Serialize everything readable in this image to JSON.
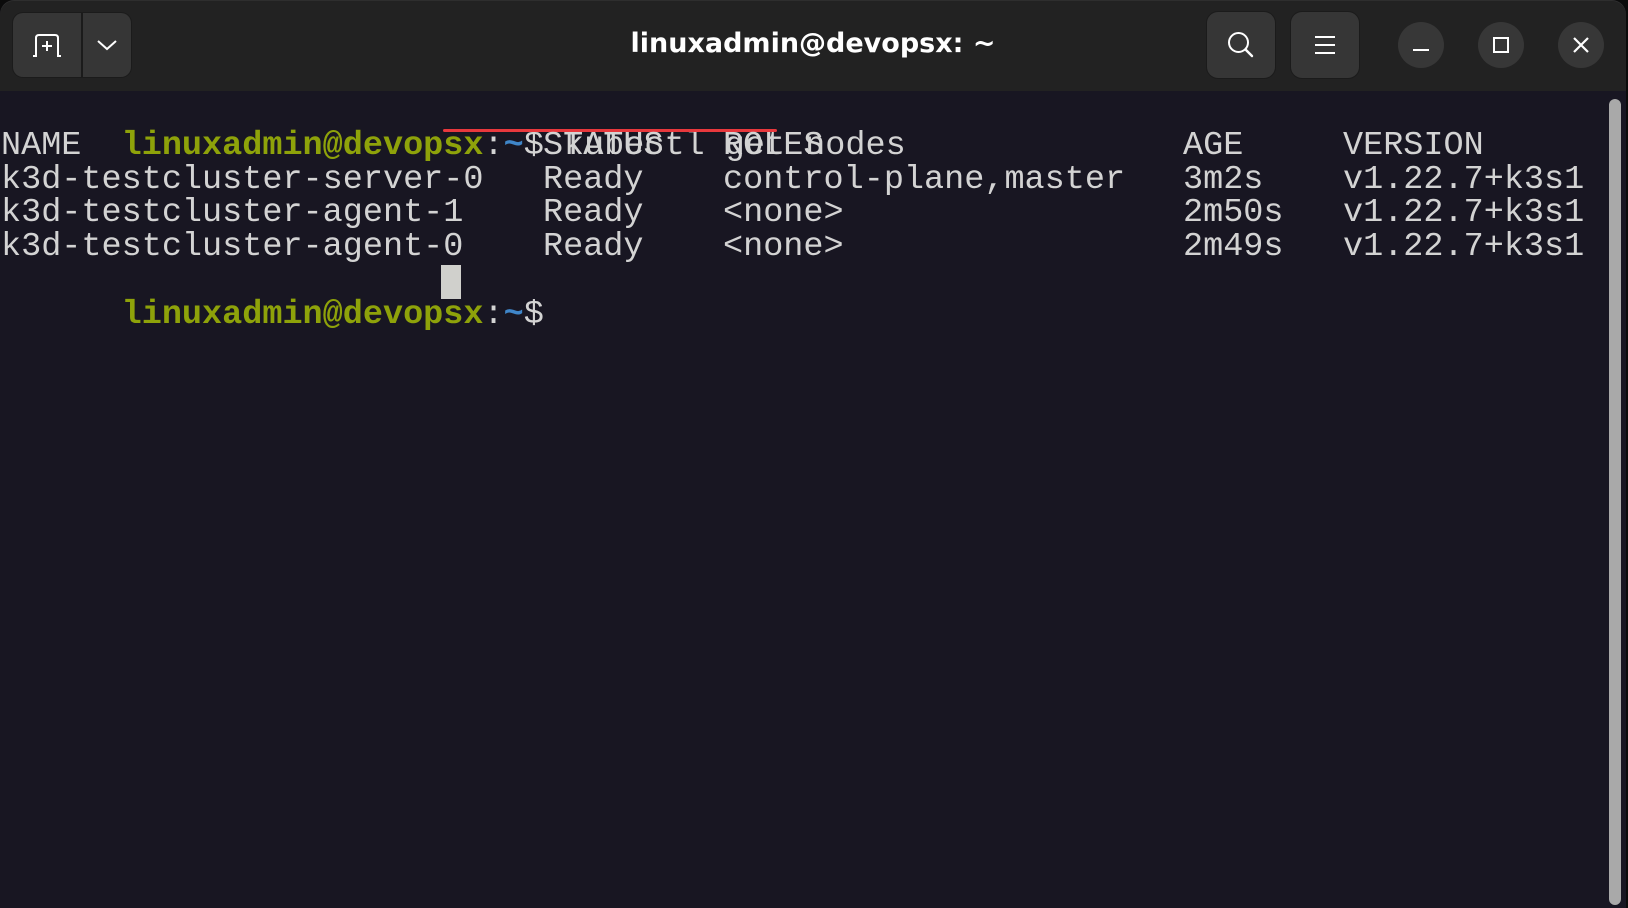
{
  "window": {
    "title": "linuxadmin@devopsx: ~"
  },
  "header": {
    "new_tab_icon": "new-tab-icon",
    "tab_menu_icon": "chevron-down-icon",
    "search_icon": "search-icon",
    "menu_icon": "hamburger-menu-icon",
    "minimize_icon": "minimize-icon",
    "maximize_icon": "maximize-icon",
    "close_icon": "close-icon"
  },
  "colors": {
    "prompt_user": "#8ea20a",
    "prompt_path": "#3f86c9",
    "text": "#d3d3d3",
    "background": "#181622",
    "annotation_underline": "#e8383d"
  },
  "terminal": {
    "prompt1": {
      "user_host": "linuxadmin@devopsx",
      "colon": ":",
      "path": "~",
      "dollar": "$",
      "command": "kubectl get nodes"
    },
    "table": {
      "headers": [
        "NAME",
        "STATUS",
        "ROLES",
        "AGE",
        "VERSION"
      ],
      "rows": [
        [
          "k3d-testcluster-server-0",
          "Ready",
          "control-plane,master",
          "3m2s",
          "v1.22.7+k3s1"
        ],
        [
          "k3d-testcluster-agent-1",
          "Ready",
          "<none>",
          "2m50s",
          "v1.22.7+k3s1"
        ],
        [
          "k3d-testcluster-agent-0",
          "Ready",
          "<none>",
          "2m49s",
          "v1.22.7+k3s1"
        ]
      ]
    },
    "prompt2": {
      "user_host": "linuxadmin@devopsx",
      "colon": ":",
      "path": "~",
      "dollar": "$",
      "command": ""
    }
  }
}
